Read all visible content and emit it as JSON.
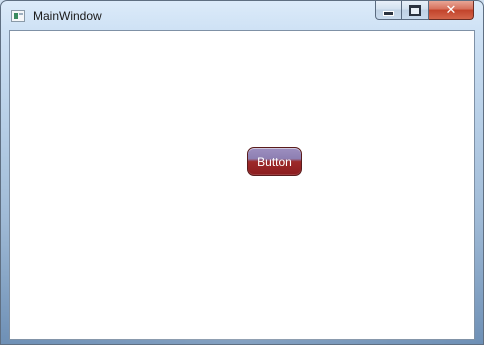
{
  "window": {
    "title": "MainWindow",
    "icon": "app-window-icon",
    "caption_buttons": {
      "minimize_icon": "minimize-icon",
      "maximize_icon": "maximize-icon",
      "close_icon": "close-icon",
      "close_glyph": "✕"
    }
  },
  "content": {
    "button_label": "Button"
  },
  "colors": {
    "button_top": "#8d7fb2",
    "button_bottom": "#8c1d1f",
    "client_background": "#ffffff"
  }
}
